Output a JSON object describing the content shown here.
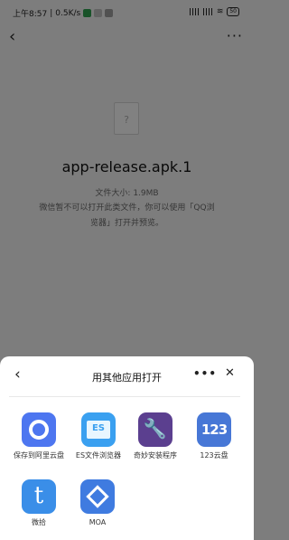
{
  "status_bar": {
    "time": "上午8:57",
    "net_speed": "0.5K/s",
    "battery": "50"
  },
  "nav": {
    "back_glyph": "‹",
    "more_glyph": "···"
  },
  "file": {
    "name": "app-release.apk.1",
    "size_text": "文件大小: 1.9MB",
    "notice": "微信暂不可以打开此类文件，你可以使用「QQ浏览器」打开并预览。",
    "icon_glyph": "?"
  },
  "sheet": {
    "title": "用其他应用打开",
    "back_glyph": "‹",
    "more_glyph": "•••",
    "close_glyph": "✕"
  },
  "apps": [
    {
      "label": "保存到阿里云盘",
      "icon": "aliyun-drive-icon"
    },
    {
      "label": "ES文件浏览器",
      "icon": "es-file-explorer-icon",
      "glyph": "ES"
    },
    {
      "label": "奇妙安装程序",
      "icon": "wrench-installer-icon",
      "glyph": "🔧"
    },
    {
      "label": "123云盘",
      "icon": "123-cloud-icon",
      "glyph": "123"
    },
    {
      "label": "微拾",
      "icon": "weishi-icon",
      "glyph": "t"
    },
    {
      "label": "MOA",
      "icon": "moa-icon"
    }
  ]
}
